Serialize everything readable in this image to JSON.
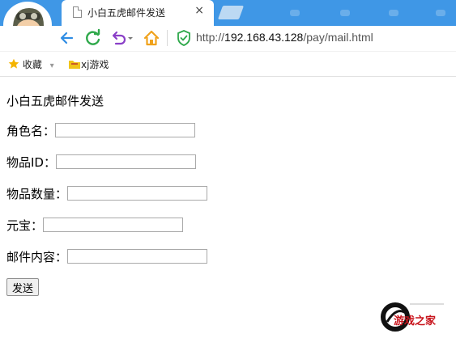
{
  "browser": {
    "tab": {
      "title": "小白五虎邮件发送",
      "close_glyph": "×"
    },
    "address": {
      "scheme": "http://",
      "host": "192.168.43.128",
      "path": "/pay/mail.html"
    },
    "bookmarks": {
      "favorites_label": "收藏",
      "favorites_caret": "▾",
      "item_label": "xj游戏"
    },
    "accent": "#3f97e6"
  },
  "page": {
    "title": "小白五虎邮件发送",
    "fields": {
      "role_name": {
        "label": "角色名：",
        "value": ""
      },
      "item_id": {
        "label": "物品ID：",
        "value": ""
      },
      "item_count": {
        "label": "物品数量：",
        "value": ""
      },
      "yuanbao": {
        "label": "元宝：",
        "value": ""
      },
      "mail_content": {
        "label": "邮件内容：",
        "value": ""
      }
    },
    "submit_label": "发送"
  },
  "watermark": {
    "logo_text": "游戏之家"
  }
}
